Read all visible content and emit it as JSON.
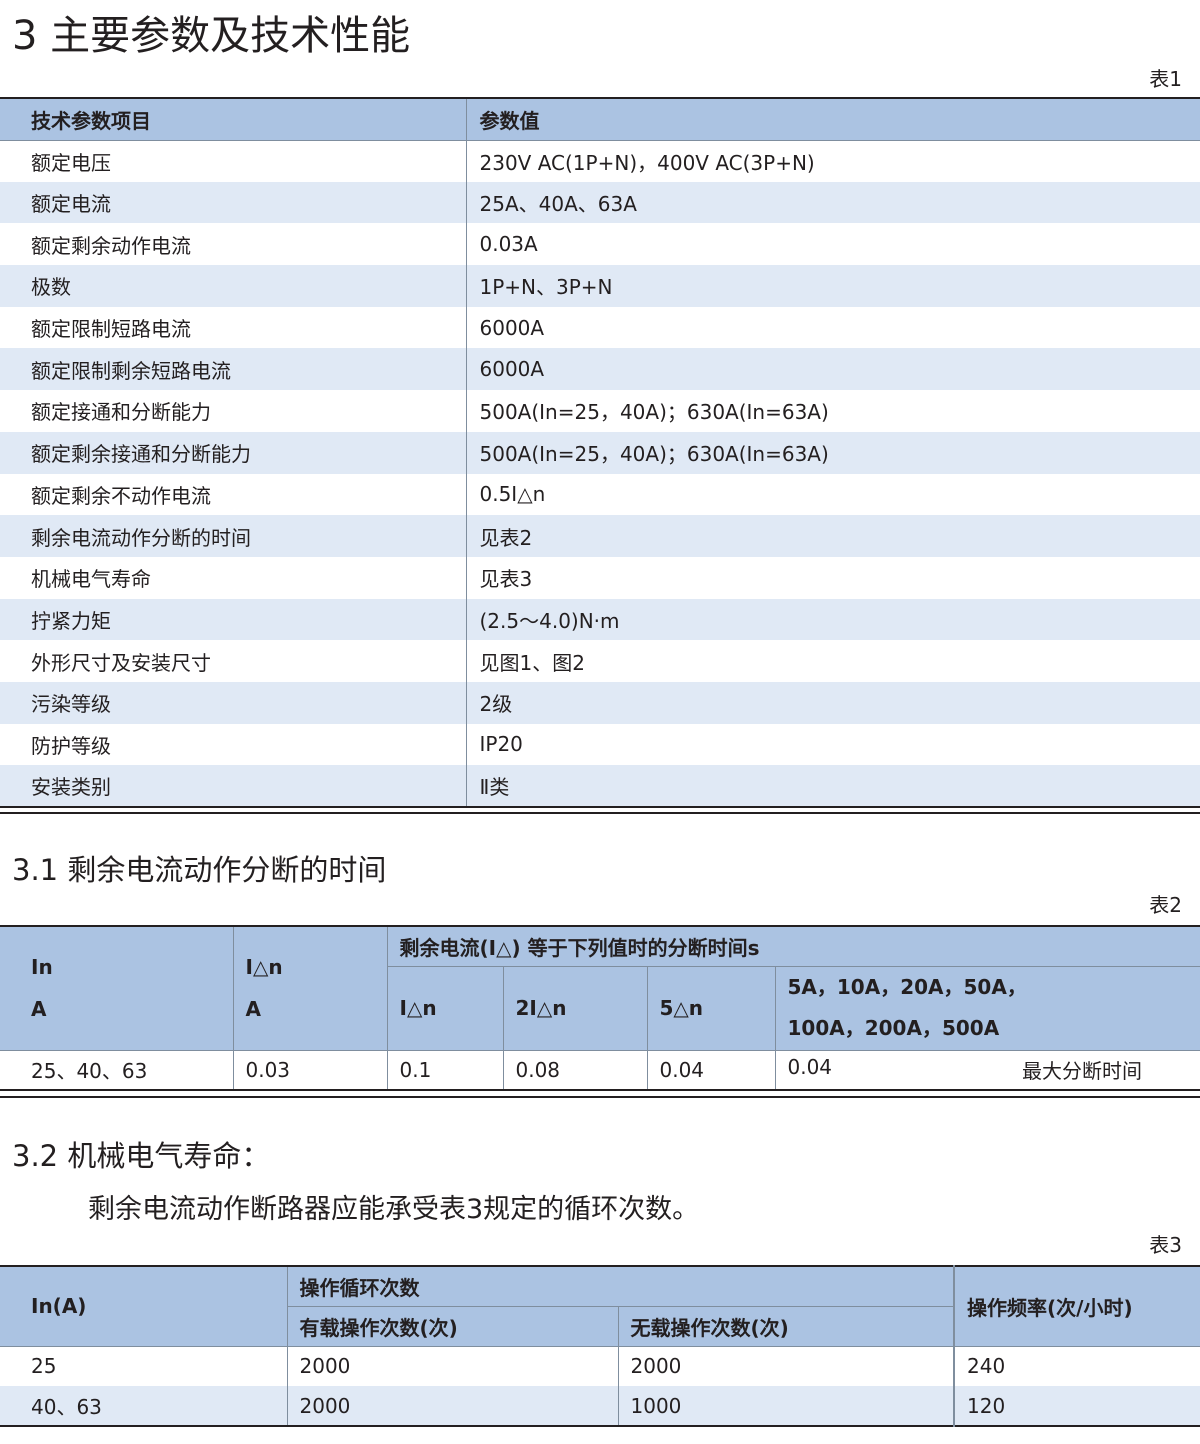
{
  "section3": {
    "title": "3 主要参数及技术性能",
    "table_label": "表1",
    "headers": [
      "技术参数项目",
      "参数值"
    ],
    "rows": [
      [
        "额定电压",
        "230V AC(1P+N)，400V AC(3P+N)"
      ],
      [
        "额定电流",
        "25A、40A、63A"
      ],
      [
        "额定剩余动作电流",
        "0.03A"
      ],
      [
        "极数",
        "1P+N、3P+N"
      ],
      [
        "额定限制短路电流",
        "6000A"
      ],
      [
        "额定限制剩余短路电流",
        "6000A"
      ],
      [
        "额定接通和分断能力",
        "500A(In=25，40A)；630A(In=63A)"
      ],
      [
        "额定剩余接通和分断能力",
        "500A(In=25，40A)；630A(In=63A)"
      ],
      [
        "额定剩余不动作电流",
        "0.5I△n"
      ],
      [
        "剩余电流动作分断的时间",
        "见表2"
      ],
      [
        "机械电气寿命",
        "见表3"
      ],
      [
        "拧紧力矩",
        "(2.5～4.0)N·m"
      ],
      [
        "外形尺寸及安装尺寸",
        "见图1、图2"
      ],
      [
        "污染等级",
        "2级"
      ],
      [
        "防护等级",
        "IP20"
      ],
      [
        "安装类别",
        "Ⅱ类"
      ]
    ]
  },
  "section31": {
    "title": "3.1 剩余电流动作分断的时间",
    "table_label": "表2",
    "header_in_line1": "In",
    "header_in_line2": "A",
    "header_idn_line1": "I△n",
    "header_idn_line2": "A",
    "group_header": "剩余电流(I△) 等于下列值时的分断时间s",
    "sub_headers": [
      "I△n",
      "2I△n",
      "5△n"
    ],
    "sub_header_last_line1": "5A，10A，20A，50A，",
    "sub_header_last_line2": "100A，200A，500A",
    "row": [
      "25、40、63",
      "0.03",
      "0.1",
      "0.08",
      "0.04",
      "0.04"
    ],
    "note": "最大分断时间"
  },
  "section32": {
    "title": "3.2 机械电气寿命：",
    "paragraph": "剩余电流动作断路器应能承受表3规定的循环次数。",
    "table_label": "表3",
    "header_in": "In(A)",
    "group_header": "操作循环次数",
    "sub_headers": [
      "有载操作次数(次)",
      "无载操作次数(次)"
    ],
    "header_freq": "操作频率(次/小时)",
    "rows": [
      [
        "25",
        "2000",
        "2000",
        "240"
      ],
      [
        "40、63",
        "2000",
        "1000",
        "120"
      ]
    ]
  }
}
